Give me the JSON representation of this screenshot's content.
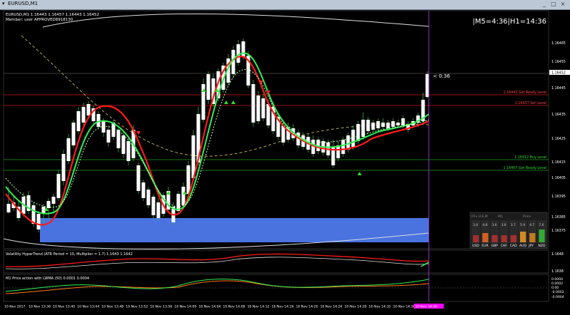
{
  "window": {
    "title": "EURUSD,M1",
    "buttons": [
      "_",
      "□",
      "×"
    ]
  },
  "main_header": {
    "line1": "EURUSD,M1  1.16443 1.16457 1.16443 1.16452",
    "line2": "Member: user   APPROVED8918130"
  },
  "timer": "|M5=4:36|H1=14:36",
  "bar_timer": "< 0:36",
  "price_axis": [
    "1.16465",
    "1.16455",
    "1.16445",
    "1.16435",
    "1.16425",
    "1.16415",
    "1.16405",
    "1.16395",
    "1.16385",
    "1.16375"
  ],
  "current_price": "1.16452",
  "levels": {
    "get_ready_sell": "1.16443 Get Ready Level",
    "sell": "1.16437 Sell Level",
    "buy": "1.16412 Buy Level",
    "get_ready_buy": "1.16407 Get Ready Level"
  },
  "strength_panel": {
    "header": [
      "FFx U.S.M",
      "M1",
      "Price"
    ],
    "values": [
      "3.6",
      "4.8",
      "3.6",
      "3.6",
      "3.7",
      "5.9",
      "4.7",
      "7.6"
    ],
    "currencies": [
      "USD",
      "EUR",
      "GBP",
      "CHF",
      "CAD",
      "AUD",
      "JPY",
      "NZD"
    ]
  },
  "subwindow1": {
    "title": "Volatility HyperTrend (ATR Period = 10, Multiplier = 1.7) 1.1643 1.1642",
    "axis": [
      "1.1648",
      "1.1638"
    ]
  },
  "subwindow2": {
    "title": "M1 Price action with LWMA (50) 0.0001 0.0004",
    "axis": [
      "0.0004",
      "0.0002",
      "0.00",
      "-0.0002",
      "-0.0004"
    ]
  },
  "time_axis": [
    "10 Nov 2017",
    "10 Nov 13:36",
    "10 Nov 13:40",
    "10 Nov 13:44",
    "10 Nov 13:48",
    "10 Nov 13:52",
    "10 Nov 13:56",
    "10 Nov 14:00",
    "10 Nov 14:04",
    "10 Nov 14:08",
    "10 Nov 14:12",
    "10 Nov 14:16",
    "10 Nov 14:20",
    "10 Nov 14:24",
    "10 Nov 14:28",
    "10 Nov 14:32",
    "10 Nov 14:36",
    "10 Nov 14:40"
  ],
  "time_marker": "10 Nov 14:40",
  "colors": {
    "bull": "#ffffff",
    "wick": "#3cb44b",
    "ma_red": "#ff1a1a",
    "ma_green": "#33ee55",
    "ma_light": "#b8ffb0",
    "ma_dashed": "#b8a64a",
    "zone": "#4a73e0",
    "level_red": "#cc1818",
    "level_green": "#1fa01f",
    "vline": "#c040ff",
    "marker_bg": "#ff00ff"
  }
}
